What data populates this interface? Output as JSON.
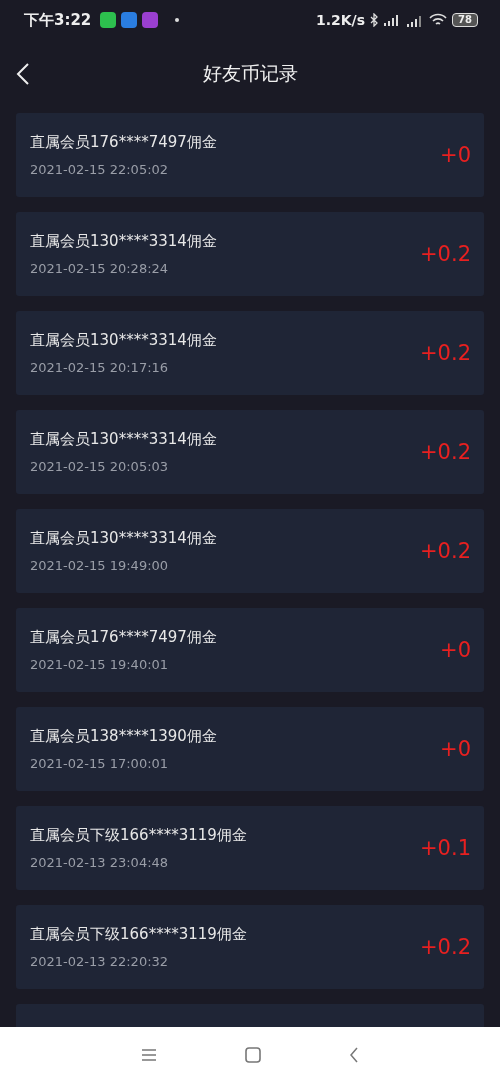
{
  "status_bar": {
    "time": "下午3:22",
    "network_speed": "1.2K/s",
    "battery": "78"
  },
  "header": {
    "title": "好友币记录"
  },
  "records": [
    {
      "title": "直属会员176****7497佣金",
      "time": "2021-02-15 22:05:02",
      "amount": "+0"
    },
    {
      "title": "直属会员130****3314佣金",
      "time": "2021-02-15 20:28:24",
      "amount": "+0.2"
    },
    {
      "title": "直属会员130****3314佣金",
      "time": "2021-02-15 20:17:16",
      "amount": "+0.2"
    },
    {
      "title": "直属会员130****3314佣金",
      "time": "2021-02-15 20:05:03",
      "amount": "+0.2"
    },
    {
      "title": "直属会员130****3314佣金",
      "time": "2021-02-15 19:49:00",
      "amount": "+0.2"
    },
    {
      "title": "直属会员176****7497佣金",
      "time": "2021-02-15 19:40:01",
      "amount": "+0"
    },
    {
      "title": "直属会员138****1390佣金",
      "time": "2021-02-15 17:00:01",
      "amount": "+0"
    },
    {
      "title": "直属会员下级166****3119佣金",
      "time": "2021-02-13 23:04:48",
      "amount": "+0.1"
    },
    {
      "title": "直属会员下级166****3119佣金",
      "time": "2021-02-13 22:20:32",
      "amount": "+0.2"
    }
  ]
}
